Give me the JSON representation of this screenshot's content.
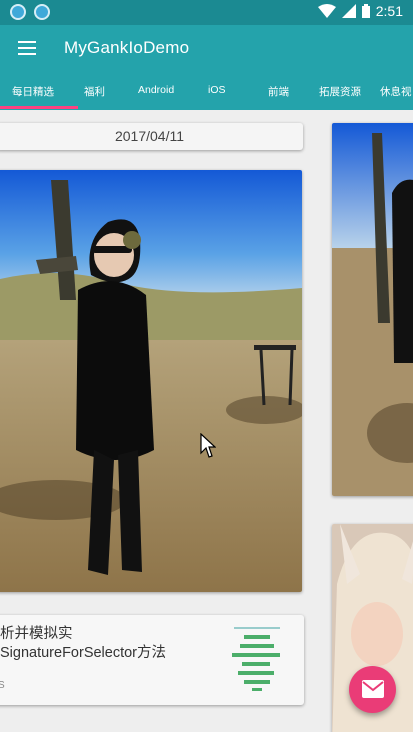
{
  "status_bar": {
    "time": "2:51",
    "notification_icons": [
      "sync-icon",
      "sync-icon"
    ],
    "icons": [
      "wifi-icon",
      "signal-icon",
      "battery-icon"
    ]
  },
  "app_bar": {
    "title": "MyGankIoDemo",
    "menu_icon": "hamburger-menu-icon"
  },
  "tabs": [
    {
      "label": "每日精选",
      "active": true
    },
    {
      "label": "福利",
      "active": false
    },
    {
      "label": "Android",
      "active": false
    },
    {
      "label": "iOS",
      "active": false
    },
    {
      "label": "前端",
      "active": false
    },
    {
      "label": "拓展资源",
      "active": false
    },
    {
      "label": "休息视",
      "active": false
    }
  ],
  "feed": {
    "date": "2017/04/11",
    "article": {
      "title_line1": "析并模拟实",
      "title_line2": "SignatureForSelector方法",
      "author": "S"
    }
  },
  "fab": {
    "icon": "email-icon"
  },
  "colors": {
    "primary": "#24a3ab",
    "primary_dark": "#1b8a92",
    "accent": "#ff4081",
    "fab": "#ea3c77"
  }
}
